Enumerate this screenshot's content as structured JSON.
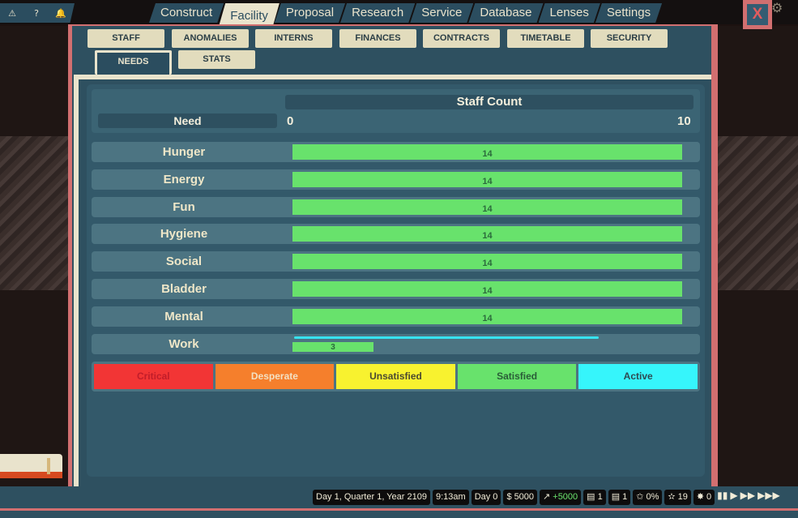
{
  "top_icons": [
    "warning-icon",
    "help-icon",
    "bell-icon"
  ],
  "top_icon_glyphs": [
    "⚠",
    "?",
    "🔔"
  ],
  "nav": {
    "tabs": [
      "Construct",
      "Facility",
      "Proposal",
      "Research",
      "Service",
      "Database",
      "Lenses",
      "Settings"
    ],
    "active": "Facility",
    "close_label": "X"
  },
  "subtabs": {
    "row1": [
      "STAFF",
      "ANOMALIES",
      "INTERNS",
      "FINANCES",
      "CONTRACTS",
      "TIMETABLE",
      "SECURITY"
    ],
    "row2": [
      "NEEDS",
      "STATS"
    ],
    "active": "NEEDS"
  },
  "chart_data": {
    "type": "bar",
    "title": "Staff Count",
    "ylabel": "Need",
    "xlim": [
      0,
      10
    ],
    "axis_min": "0",
    "axis_max": "10",
    "categories": [
      "Hunger",
      "Energy",
      "Fun",
      "Hygiene",
      "Social",
      "Bladder",
      "Mental",
      "Work"
    ],
    "values": [
      14,
      14,
      14,
      14,
      14,
      14,
      14,
      3
    ],
    "bar_color": "#68e26c",
    "active_line_color": "#37e3ef",
    "legend": [
      {
        "label": "Critical",
        "color": "#f23535",
        "text_color": "#c11d2a"
      },
      {
        "label": "Desperate",
        "color": "#f57f2c",
        "text_color": "#f3e1c3"
      },
      {
        "label": "Unsatisfied",
        "color": "#f8f22f",
        "text_color": "#4b4930"
      },
      {
        "label": "Satisfied",
        "color": "#68e26c",
        "text_color": "#2a5d38"
      },
      {
        "label": "Active",
        "color": "#36f5fb",
        "text_color": "#2e4a52"
      }
    ]
  },
  "status": {
    "date": "Day 1, Quarter 1, Year 2109",
    "time": "9:13am",
    "day": "Day 0",
    "money": "5000",
    "income": "+5000",
    "calendar1": "1",
    "calendar2": "1",
    "approval": "0%",
    "stars": "19",
    "bugs": "0"
  }
}
